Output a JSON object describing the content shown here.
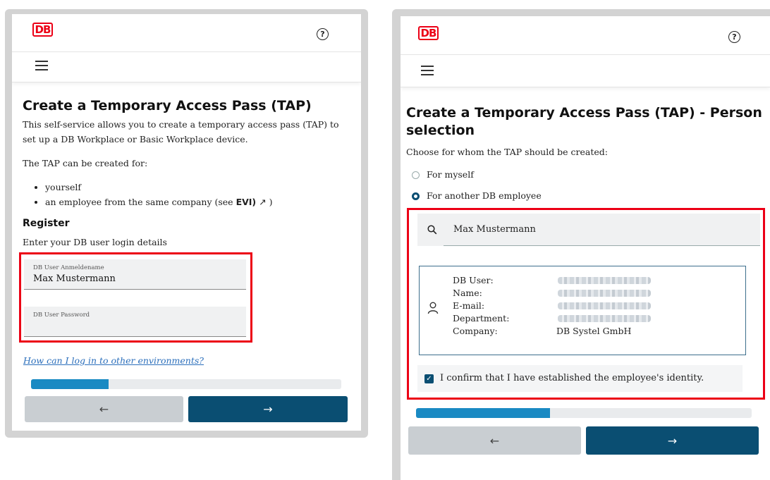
{
  "left": {
    "logo": "DB",
    "help": "?",
    "title": "Create a Temporary Access Pass (TAP)",
    "intro": "This self-service allows you to create a temporary access pass (TAP) to set up a DB Workplace or Basic Workplace device.",
    "intro_line1": "This self-service allows you to create a temporary access pass (TAP) to",
    "intro_line2": "set up a DB Workplace or Basic Workplace device.",
    "created_for": "The TAP can be created for:",
    "bullets": [
      "yourself",
      "an employee from the same company (see "
    ],
    "evi": "EVI)",
    "evi_arrow": "↗",
    "evi_close": " )",
    "register_heading": "Register",
    "register_sub": "Enter your DB user login details",
    "username_label": "DB User Anmeldename",
    "username_value": "Max Mustermann",
    "password_label": "DB User Password",
    "help_link": "How can I log in to other environments?",
    "progress": 0.25,
    "back": "←",
    "next": "→"
  },
  "right": {
    "logo": "DB",
    "help": "?",
    "title_line1": "Create a Temporary Access Pass (TAP) - Person",
    "title_line2": "selection",
    "instruction": "Choose for whom the TAP should be created:",
    "option_self": "For myself",
    "option_other": "For another DB employee",
    "search_icon": "magnifier-icon",
    "search_value": "Max Mustermann",
    "fields": [
      "DB User:",
      "Name:",
      "E-mail:",
      "Department:",
      "Company:"
    ],
    "company": "DB Systel GmbH",
    "confirm": "I confirm that I have established the employee's identity.",
    "progress": 0.4,
    "back": "←",
    "next": "→"
  },
  "colors": {
    "accent": "#ec0016",
    "primary": "#0a4e72",
    "progress": "#1a8ac3"
  }
}
